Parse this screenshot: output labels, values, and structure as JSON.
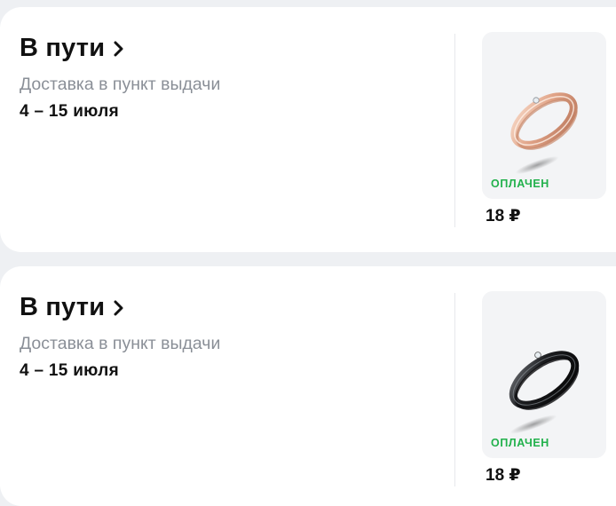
{
  "orders": [
    {
      "status_label": "В пути",
      "delivery_label": "Доставка в пункт выдачи",
      "dates": "4 – 15 июля",
      "product": {
        "image": "rose-gold-ring",
        "badge": "ОПЛАЧЕН",
        "price": "18 ₽"
      }
    },
    {
      "status_label": "В пути",
      "delivery_label": "Доставка в пункт выдачи",
      "dates": "4 – 15 июля",
      "product": {
        "image": "black-ring",
        "badge": "ОПЛАЧЕН",
        "price": "18 ₽"
      }
    }
  ],
  "colors": {
    "paid_badge": "#22b14c",
    "page_background": "#eef0f3",
    "card_background": "#ffffff"
  }
}
